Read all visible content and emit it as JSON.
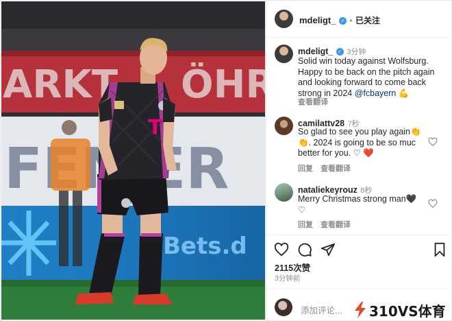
{
  "header": {
    "username": "mdeligt_",
    "separator": "•",
    "follow_status": "已关注"
  },
  "caption": {
    "username": "mdeligt_",
    "time": "3分钟",
    "lines": [
      "Solid win today against Wolfsburg.",
      "Happy to be back on the pitch again",
      "and looking forward to come back"
    ],
    "line4_text": "strong in 2024 ",
    "mention": "@fcbayern",
    "emoji": "💪",
    "translate": "查看翻译"
  },
  "comments": [
    {
      "username": "camilattv28",
      "time": "7秒",
      "lines": [
        "So glad to see you play again👏",
        "👏. 2024 is going to be so muc",
        "better for you. ♡ ❤️"
      ],
      "reply": "回复",
      "translate": "查看翻译"
    },
    {
      "username": "nataliekeyrouz",
      "time": "8秒",
      "lines": [
        "Merry Christmas strong man🖤",
        "♡"
      ],
      "reply": "回复",
      "translate": "查看翻译"
    }
  ],
  "actions": {
    "icons": [
      "heart-icon",
      "comment-icon",
      "share-icon",
      "save-icon"
    ]
  },
  "likes": "2115次赞",
  "timestamp": "3分钟前",
  "add_comment": {
    "placeholder": "添加评论..."
  },
  "photo": {
    "banner_left": "ARKT",
    "banner_right": "ÖHR",
    "board_text": "FEN  ER",
    "ad_text": "Bets.d",
    "shirt_sponsor": "T"
  },
  "watermark": "310VS体育",
  "colors": {
    "verified": "#3897f0",
    "mention": "#00376b",
    "muted": "#8e8e8e",
    "heart_red": "#ed4956"
  }
}
